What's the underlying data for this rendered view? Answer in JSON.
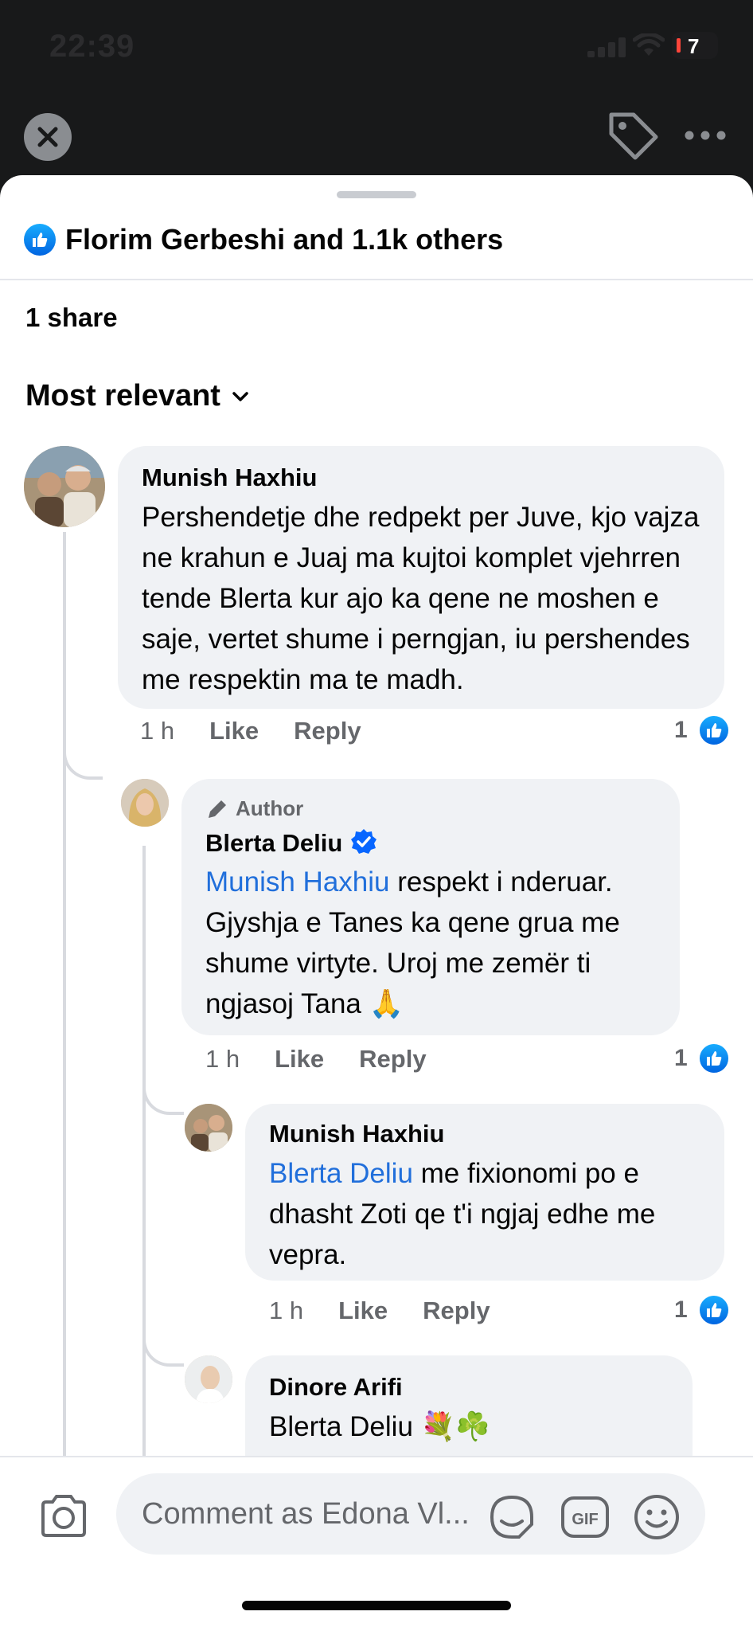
{
  "status": {
    "time": "22:39",
    "battery": "7"
  },
  "header": {
    "close_icon": "close-icon",
    "tag_icon": "tag-icon",
    "more_icon": "more-icon"
  },
  "reactions": {
    "summary": "Florim Gerbeshi and 1.1k others"
  },
  "shares": "1 share",
  "sort": {
    "label": "Most relevant"
  },
  "comments": [
    {
      "name": "Munish Haxhiu",
      "text": "Pershendetje dhe redpekt per Juve, kjo vajza ne krahun e Juaj ma kujtoi komplet vjehrren tende Blerta kur ajo ka qene ne moshen e saje, vertet shume i perngjan, iu pershendes me respektin ma te madh.",
      "time": "1 h",
      "like": "Like",
      "reply": "Reply",
      "likes": "1"
    },
    {
      "author_label": "Author",
      "name": "Blerta Deliu",
      "mention": "Munish Haxhiu",
      "text": " respekt i nderuar. Gjyshja e Tanes ka qene grua me shume virtyte. Uroj me zemër ti ngjasoj Tana 🙏",
      "time": "1 h",
      "like": "Like",
      "reply": "Reply",
      "likes": "1"
    },
    {
      "name": "Munish Haxhiu",
      "mention": "Blerta Deliu",
      "text": " me fixionomi po e dhasht Zoti qe t'i ngjaj edhe me vepra.",
      "time": "1 h",
      "like": "Like",
      "reply": "Reply",
      "likes": "1"
    },
    {
      "name": "Dinore Arifi",
      "text": "Blerta Deliu 💐☘️"
    }
  ],
  "composer": {
    "placeholder": "Comment as Edona Vl..."
  },
  "colors": {
    "accent": "#216fdb",
    "like_blue": "#0866ff",
    "bubble": "#f0f2f5"
  }
}
